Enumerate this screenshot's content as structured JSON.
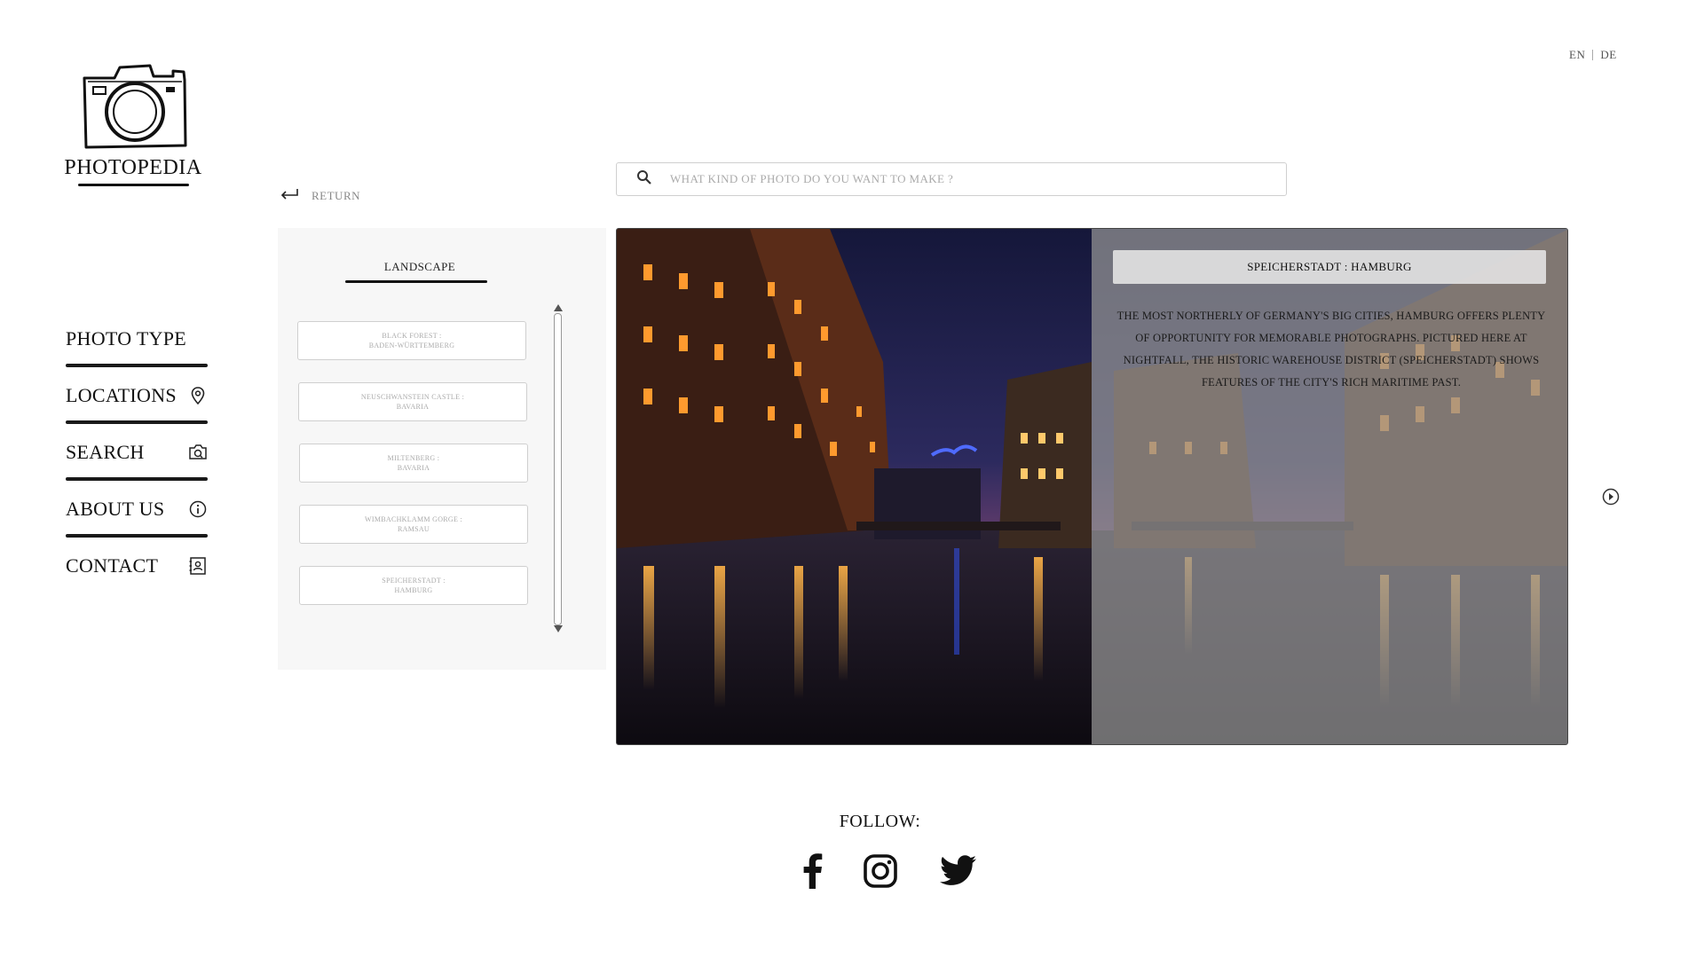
{
  "app": {
    "name": "PHOTOPEDIA"
  },
  "language": {
    "options": [
      "EN",
      "DE"
    ],
    "selected": "EN"
  },
  "nav": {
    "items": [
      {
        "label": "PHOTO TYPE",
        "icon": ""
      },
      {
        "label": "LOCATIONS",
        "icon": "map-pin-icon"
      },
      {
        "label": "SEARCH",
        "icon": "camera-search-icon"
      },
      {
        "label": "ABOUT US",
        "icon": "info-icon"
      },
      {
        "label": "CONTACT",
        "icon": "contact-card-icon"
      }
    ]
  },
  "return_label": "RETURN",
  "search": {
    "placeholder": "WHAT KIND OF PHOTO DO YOU WANT TO MAKE ?",
    "value": ""
  },
  "panel": {
    "title": "LANDSCAPE",
    "locations": [
      {
        "line1": "BLACK FOREST :",
        "line2": "BADEN-WÜRTTEMBERG"
      },
      {
        "line1": "NEUSCHWANSTEIN CASTLE :",
        "line2": "BAVARIA"
      },
      {
        "line1": "MILTENBERG :",
        "line2": "BAVARIA"
      },
      {
        "line1": "WIMBACHKLAMM GORGE :",
        "line2": "RAMSAU"
      },
      {
        "line1": "SPEICHERSTADT :",
        "line2": "HAMBURG"
      }
    ]
  },
  "feature": {
    "title": "SPEICHERSTADT : HAMBURG",
    "description": "THE MOST NORTHERLY OF GERMANY'S BIG CITIES, HAMBURG OFFERS PLENTY OF OPPORTUNITY FOR MEMORABLE PHOTOGRAPHS. PICTURED HERE AT NIGHTFALL, THE HISTORIC WAREHOUSE DISTRICT (SPEICHERSTADT) SHOWS FEATURES OF THE CITY'S RICH MARITIME PAST."
  },
  "footer": {
    "follow_label": "FOLLOW:",
    "social": [
      "facebook-icon",
      "instagram-icon",
      "twitter-icon"
    ]
  }
}
